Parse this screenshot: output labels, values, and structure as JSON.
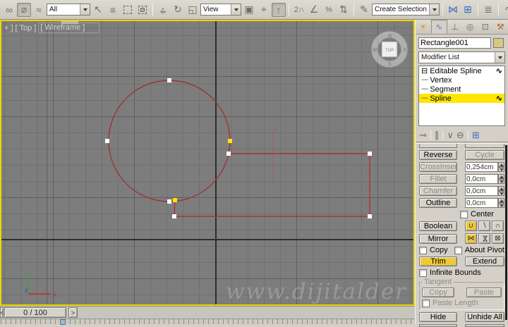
{
  "colors": {
    "toolbar_bg": "#d4d0c8",
    "viewport_bg": "#7d7d7d",
    "active_viewport_border": "#ecd800",
    "spline_red": "#a83232",
    "highlight_yellow": "#f0c832",
    "stack_selected": "#ffe600",
    "object_swatch": "#d9c87f"
  },
  "toolbar": {
    "filters": {
      "selection_filter": "All",
      "coord_system": "View",
      "named_set": "Create Selection Se"
    },
    "icons": {
      "select_and_link": "∞",
      "unlink_selection": "⌀",
      "bind_to_space_warp": "≈",
      "select_object": "↖",
      "select_by_name": "≡",
      "select_and_move_h": "↔",
      "select_and_move_v": "↕",
      "select_and_rotate": "↻",
      "select_and_scale": "◱",
      "use_pivot_point_center": "▣",
      "select_and_manipulate": "⌖",
      "keyboard_shortcut_override": "↑",
      "snap_toggle": "2∩",
      "angle_snap": "∠",
      "percent_snap": "%",
      "spinner_snap": "⇅",
      "edit_named_selection_sets": "✎",
      "mirror": "⋈",
      "align": "⊞",
      "layer_manager": "≣",
      "curve_editor": "∿",
      "schematic_view": "⊡",
      "material_editor": "◐"
    }
  },
  "viewport": {
    "label_plus": "+ ]",
    "label_view": "[ Top ]",
    "label_shading": "[ Wireframe ]",
    "viewcube": {
      "top": "TOP",
      "n": "N",
      "e": "E",
      "s": "S",
      "w": "W"
    },
    "axis": {
      "x": "x",
      "y": "y",
      "z": "z"
    },
    "gizmo_x": "x",
    "watermark": "www.dijitalder"
  },
  "panel": {
    "tabs": {
      "create": "☀",
      "modify": "∿",
      "hierarchy": "⊥",
      "motion": "◎",
      "display": "⊡",
      "utilities": "⚒"
    },
    "object_name": "Rectangle001",
    "modifier_list": "Modifier List",
    "stack": {
      "expander": "⊟",
      "squiggle": "∿",
      "branch": "----",
      "items": [
        {
          "label": "Editable Spline"
        },
        {
          "label": "Vertex"
        },
        {
          "label": "Segment"
        },
        {
          "label": "Spline"
        }
      ]
    },
    "stack_tools": {
      "pin": "⊸",
      "show_end_result": "∥",
      "make_unique": "∨",
      "remove_modifier": "⊖",
      "configure_sets": "⊞"
    },
    "rollout": {
      "reverse": "Reverse",
      "cycle": "Cycle",
      "cross_insert": "CrossInsert",
      "cross_insert_value": "0,254cm",
      "fillet": "Fillet",
      "fillet_value": "0,0cm",
      "chamfer": "Chamfer",
      "chamfer_value": "0,0cm",
      "outline": "Outline",
      "outline_value": "0,0cm",
      "center": "Center",
      "boolean": "Boolean",
      "bool_union": "∪",
      "bool_subtract": "∖",
      "bool_intersect": "∩",
      "mirror": "Mirror",
      "mirror_h": "⋈",
      "mirror_v": "⋈",
      "mirror_both": "⊠",
      "copy": "Copy",
      "about_pivot": "About Pivot",
      "trim": "Trim",
      "extend": "Extend",
      "infinite_bounds": "Infinite Bounds",
      "tangent": "Tangent",
      "tangent_copy": "Copy",
      "tangent_paste": "Paste",
      "paste_length": "Paste Length",
      "hide": "Hide",
      "unhide_all": "Unhide All"
    }
  },
  "timeline": {
    "prev": "<",
    "frame": "0 / 100",
    "next": ">"
  }
}
